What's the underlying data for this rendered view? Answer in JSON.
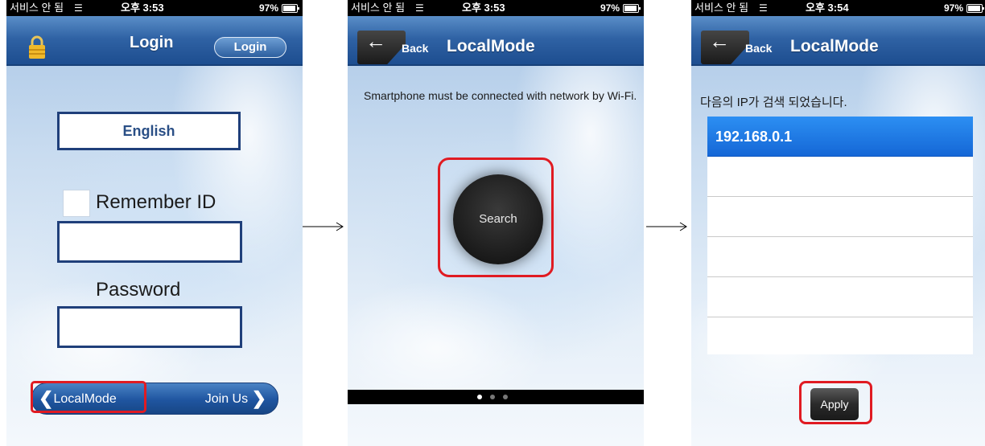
{
  "status_bars": [
    {
      "carrier": "서비스 안 됨",
      "time": "오후 3:53",
      "battery": "97%"
    },
    {
      "carrier": "서비스 안 됨",
      "time": "오후 3:53",
      "battery": "97%"
    },
    {
      "carrier": "서비스 안 됨",
      "time": "오후 3:54",
      "battery": "97%"
    }
  ],
  "login_screen": {
    "title": "Login",
    "nav_login_button": "Login",
    "language": "English",
    "remember_label": "Remember ID",
    "id_value": "",
    "password_label": "Password",
    "password_value": "",
    "localmode_button": "LocalMode",
    "joinus_button": "Join Us"
  },
  "search_screen": {
    "back_label": "Back",
    "title": "LocalMode",
    "info": "Smartphone must be connected with network by Wi-Fi.",
    "search_button": "Search",
    "page_count": 3,
    "active_page": 1
  },
  "result_screen": {
    "back_label": "Back",
    "title": "LocalMode",
    "found_text": "다음의 IP가 검색 되었습니다.",
    "ips": [
      "192.168.0.1",
      "",
      "",
      "",
      "",
      ""
    ],
    "apply_button": "Apply"
  },
  "colors": {
    "highlight": "#e01b22",
    "nav_blue": "#2f62a4",
    "selected_row": "#1a74e4"
  }
}
